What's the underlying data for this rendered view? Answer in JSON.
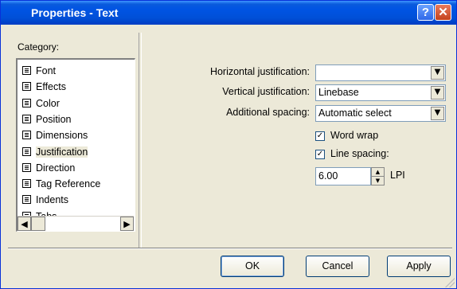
{
  "window": {
    "title": "Properties - Text",
    "help_glyph": "?",
    "close_glyph": "✕"
  },
  "category": {
    "label": "Category:",
    "items": [
      {
        "label": "Font"
      },
      {
        "label": "Effects"
      },
      {
        "label": "Color"
      },
      {
        "label": "Position"
      },
      {
        "label": "Dimensions"
      },
      {
        "label": "Justification",
        "selected": true
      },
      {
        "label": "Direction"
      },
      {
        "label": "Tag Reference"
      },
      {
        "label": "Indents"
      },
      {
        "label": "Tabs"
      }
    ],
    "scroll_left": "◀",
    "scroll_right": "▶"
  },
  "fields": {
    "horizontal": {
      "label": "Horizontal justification:",
      "value": ""
    },
    "vertical": {
      "label": "Vertical justification:",
      "value": "Linebase"
    },
    "spacing": {
      "label": "Additional spacing:",
      "value": "Automatic select"
    },
    "dropdown_glyph": "▼"
  },
  "word_wrap": {
    "label": "Word wrap",
    "checked": true,
    "mark": "✓"
  },
  "line_spacing": {
    "label": "Line spacing:",
    "checked": true,
    "mark": "✓",
    "value": "6.00",
    "unit": "LPI",
    "up": "▲",
    "down": "▼"
  },
  "buttons": {
    "ok": "OK",
    "cancel": "Cancel",
    "apply": "Apply"
  },
  "colors": {
    "titlebar": "#0054e3",
    "face": "#ece9d8",
    "close": "#c4421c"
  }
}
